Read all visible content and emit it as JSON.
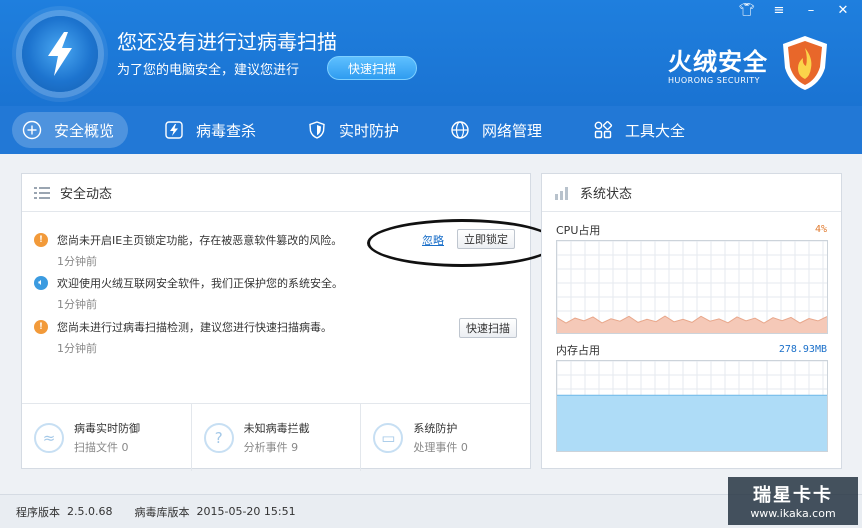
{
  "header": {
    "title": "您还没有进行过病毒扫描",
    "subtitle": "为了您的电脑安全，建议您进行",
    "quick_scan_label": "快速扫描",
    "brand_name": "火绒安全",
    "brand_en": "HUORONG SECURITY"
  },
  "window_controls": [
    "skin-icon",
    "menu-icon",
    "minimize-icon",
    "close-icon"
  ],
  "nav": {
    "items": [
      {
        "label": "安全概览",
        "icon": "plus-circle-icon",
        "active": true
      },
      {
        "label": "病毒查杀",
        "icon": "bolt-icon",
        "active": false
      },
      {
        "label": "实时防护",
        "icon": "shield-icon",
        "active": false
      },
      {
        "label": "网络管理",
        "icon": "globe-icon",
        "active": false
      },
      {
        "label": "工具大全",
        "icon": "grid-icon",
        "active": false
      }
    ]
  },
  "security_events": {
    "title": "安全动态",
    "items": [
      {
        "text": "您尚未开启IE主页锁定功能，存在被恶意软件篡改的风险。",
        "time": "1分钟前",
        "icon": "warning-icon",
        "ignore_label": "忽略",
        "action_label": "立即锁定"
      },
      {
        "text": "欢迎使用火绒互联网安全软件，我们正保护您的系统安全。",
        "time": "1分钟前",
        "icon": "speaker-icon"
      },
      {
        "text": "您尚未进行过病毒扫描检测，建议您进行快速扫描病毒。",
        "time": "1分钟前",
        "icon": "warning-icon",
        "action_label": "快速扫描"
      }
    ],
    "stats": [
      {
        "title": "病毒实时防御",
        "sub": "扫描文件 0",
        "icon": "pulse-icon"
      },
      {
        "title": "未知病毒拦截",
        "sub": "分析事件 9",
        "icon": "question-icon"
      },
      {
        "title": "系统防护",
        "sub": "处理事件 0",
        "icon": "monitor-icon"
      }
    ]
  },
  "system_status": {
    "title": "系统状态",
    "cpu_label": "CPU占用",
    "cpu_value": "4%",
    "mem_label": "内存占用",
    "mem_value": "278.93MB",
    "cpu_fill_fraction": 0.14,
    "mem_fill_fraction": 0.62
  },
  "footer": {
    "program_version_label": "程序版本",
    "program_version": "2.5.0.68",
    "db_version_label": "病毒库版本",
    "db_version": "2015-05-20 15:51"
  },
  "watermark": {
    "top": "瑞星卡卡",
    "bottom": "www.ikaka.com"
  },
  "colors": {
    "header_blue": "#1f7fde",
    "nav_blue": "#2278d6",
    "warning_orange": "#f29a3a",
    "info_blue": "#3b9be0",
    "cpu_fill": "#f5c9b8",
    "mem_fill": "#aedcf7"
  }
}
